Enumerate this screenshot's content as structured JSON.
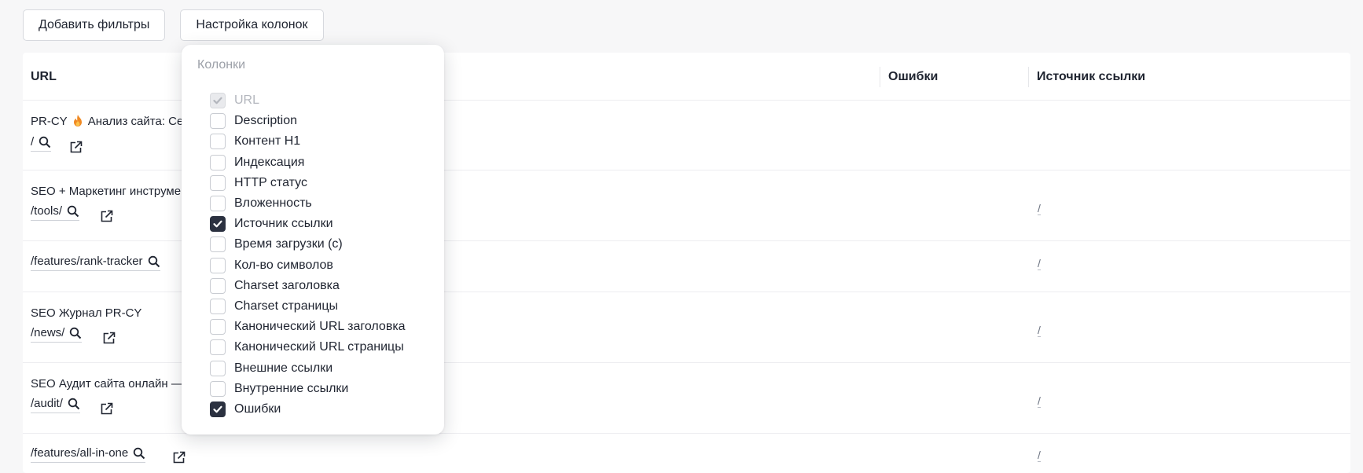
{
  "toolbar": {
    "add_filters": "Добавить фильтры",
    "columns_settings": "Настройка колонок"
  },
  "table": {
    "headers": {
      "url": "URL",
      "errors": "Ошибки",
      "link_source": "Источник ссылки"
    },
    "rows": [
      {
        "title": "PR-CY",
        "title_suffix": "Анализ сайта: Се",
        "path": "/",
        "source": ""
      },
      {
        "title": "SEO + Маркетинг инструме",
        "path": "/tools/",
        "source": "/"
      },
      {
        "title": "",
        "path": "/features/rank-tracker",
        "source": "/"
      },
      {
        "title": "SEO Журнал PR-CY",
        "path": "/news/",
        "source": "/"
      },
      {
        "title": "SEO Аудит сайта онлайн —",
        "path": "/audit/",
        "source": "/"
      },
      {
        "title": "",
        "path": "/features/all-in-one",
        "source": "/"
      }
    ]
  },
  "columns_menu": {
    "title": "Колонки",
    "options": [
      {
        "label": "URL",
        "checked": true,
        "disabled": true
      },
      {
        "label": "Description",
        "checked": false
      },
      {
        "label": "Контент H1",
        "checked": false
      },
      {
        "label": "Индексация",
        "checked": false
      },
      {
        "label": "HTTP статус",
        "checked": false
      },
      {
        "label": "Вложенность",
        "checked": false
      },
      {
        "label": "Источник ссылки",
        "checked": true
      },
      {
        "label": "Время загрузки (с)",
        "checked": false
      },
      {
        "label": "Кол-во символов",
        "checked": false
      },
      {
        "label": "Charset заголовка",
        "checked": false
      },
      {
        "label": "Charset страницы",
        "checked": false
      },
      {
        "label": "Канонический URL заголовка",
        "checked": false
      },
      {
        "label": "Канонический URL страницы",
        "checked": false
      },
      {
        "label": "Внешние ссылки",
        "checked": false
      },
      {
        "label": "Внутренние ссылки",
        "checked": false
      },
      {
        "label": "Ошибки",
        "checked": true
      }
    ]
  },
  "icons": {
    "search": "search-icon",
    "external_link": "external-link-icon",
    "fire": "fire-icon",
    "check": "check-icon"
  },
  "colors": {
    "checkbox_checked": "#2b3140",
    "text": "#1f2430",
    "muted": "#9ca0a8"
  }
}
